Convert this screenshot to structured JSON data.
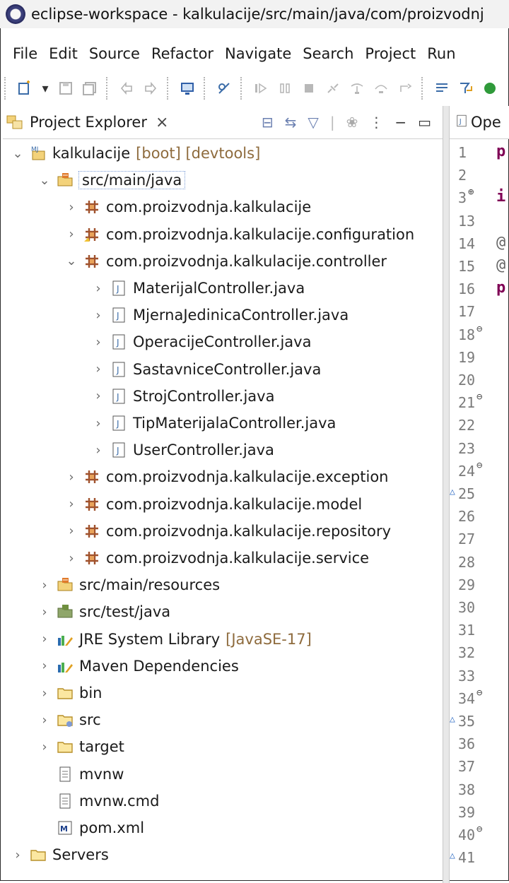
{
  "window": {
    "title": "eclipse-workspace - kalkulacije/src/main/java/com/proizvodnj"
  },
  "menu": [
    "File",
    "Edit",
    "Source",
    "Refactor",
    "Navigate",
    "Search",
    "Project",
    "Run"
  ],
  "explorer": {
    "tab_label": "Project Explorer",
    "close_glyph": "×",
    "tree": [
      {
        "label": "kalkulacije",
        "decoration": "[boot] [devtools]",
        "indent": 0,
        "arrow": "open",
        "icon": "project"
      },
      {
        "label": "src/main/java",
        "indent": 1,
        "arrow": "open",
        "icon": "source-folder"
      },
      {
        "label": "com.proizvodnja.kalkulacije",
        "indent": 2,
        "arrow": "closed",
        "icon": "package"
      },
      {
        "label": "com.proizvodnja.kalkulacije.configuration",
        "indent": 2,
        "arrow": "closed",
        "icon": "package-special"
      },
      {
        "label": "com.proizvodnja.kalkulacije.controller",
        "indent": 2,
        "arrow": "open",
        "icon": "package"
      },
      {
        "label": "MaterijalController.java",
        "indent": 3,
        "arrow": "closed",
        "icon": "java-file"
      },
      {
        "label": "MjernaJedinicaController.java",
        "indent": 3,
        "arrow": "closed",
        "icon": "java-file"
      },
      {
        "label": "OperacijeController.java",
        "indent": 3,
        "arrow": "closed",
        "icon": "java-file"
      },
      {
        "label": "SastavniceController.java",
        "indent": 3,
        "arrow": "closed",
        "icon": "java-file"
      },
      {
        "label": "StrojController.java",
        "indent": 3,
        "arrow": "closed",
        "icon": "java-file"
      },
      {
        "label": "TipMaterijalaController.java",
        "indent": 3,
        "arrow": "closed",
        "icon": "java-file"
      },
      {
        "label": "UserController.java",
        "indent": 3,
        "arrow": "closed",
        "icon": "java-file"
      },
      {
        "label": "com.proizvodnja.kalkulacije.exception",
        "indent": 2,
        "arrow": "closed",
        "icon": "package"
      },
      {
        "label": "com.proizvodnja.kalkulacije.model",
        "indent": 2,
        "arrow": "closed",
        "icon": "package"
      },
      {
        "label": "com.proizvodnja.kalkulacije.repository",
        "indent": 2,
        "arrow": "closed",
        "icon": "package"
      },
      {
        "label": "com.proizvodnja.kalkulacije.service",
        "indent": 2,
        "arrow": "closed",
        "icon": "package"
      },
      {
        "label": "src/main/resources",
        "indent": 1,
        "arrow": "closed",
        "icon": "source-folder"
      },
      {
        "label": "src/test/java",
        "indent": 1,
        "arrow": "closed",
        "icon": "source-folder-test"
      },
      {
        "label": "JRE System Library",
        "decoration": "[JavaSE-17]",
        "indent": 1,
        "arrow": "closed",
        "icon": "library"
      },
      {
        "label": "Maven Dependencies",
        "indent": 1,
        "arrow": "closed",
        "icon": "library"
      },
      {
        "label": "bin",
        "indent": 1,
        "arrow": "closed",
        "icon": "folder"
      },
      {
        "label": "src",
        "indent": 1,
        "arrow": "closed",
        "icon": "folder-src"
      },
      {
        "label": "target",
        "indent": 1,
        "arrow": "closed",
        "icon": "folder"
      },
      {
        "label": "mvnw",
        "indent": 1,
        "arrow": "none",
        "icon": "text-file"
      },
      {
        "label": "mvnw.cmd",
        "indent": 1,
        "arrow": "none",
        "icon": "text-file"
      },
      {
        "label": "pom.xml",
        "indent": 1,
        "arrow": "none",
        "icon": "maven-file"
      },
      {
        "label": "Servers",
        "indent": 0,
        "arrow": "closed",
        "icon": "folder"
      }
    ]
  },
  "editor": {
    "tab_label": "Ope",
    "lines": [
      {
        "n": "1",
        "code": "p"
      },
      {
        "n": "2",
        "code": ""
      },
      {
        "n": "3",
        "mark": "⊕",
        "code": "i"
      },
      {
        "n": "13",
        "code": ""
      },
      {
        "n": "14",
        "code": "@"
      },
      {
        "n": "15",
        "code": "@"
      },
      {
        "n": "16",
        "code": "p"
      },
      {
        "n": "17",
        "code": ""
      },
      {
        "n": "18",
        "mark": "⊖",
        "code": ""
      },
      {
        "n": "19",
        "code": ""
      },
      {
        "n": "20",
        "code": ""
      },
      {
        "n": "21",
        "mark": "⊖",
        "code": ""
      },
      {
        "n": "22",
        "code": ""
      },
      {
        "n": "23",
        "code": ""
      },
      {
        "n": "24",
        "mark": "⊖",
        "code": ""
      },
      {
        "n": "25",
        "warn": "△",
        "code": ""
      },
      {
        "n": "26",
        "code": ""
      },
      {
        "n": "27",
        "code": ""
      },
      {
        "n": "28",
        "code": ""
      },
      {
        "n": "29",
        "code": ""
      },
      {
        "n": "30",
        "code": ""
      },
      {
        "n": "31",
        "code": ""
      },
      {
        "n": "32",
        "code": ""
      },
      {
        "n": "33",
        "code": ""
      },
      {
        "n": "34",
        "mark": "⊖",
        "code": ""
      },
      {
        "n": "35",
        "warn": "△",
        "code": ""
      },
      {
        "n": "36",
        "code": ""
      },
      {
        "n": "37",
        "code": ""
      },
      {
        "n": "38",
        "code": ""
      },
      {
        "n": "39",
        "code": ""
      },
      {
        "n": "40",
        "mark": "⊖",
        "code": ""
      },
      {
        "n": "41",
        "warn": "△",
        "code": ""
      }
    ]
  }
}
